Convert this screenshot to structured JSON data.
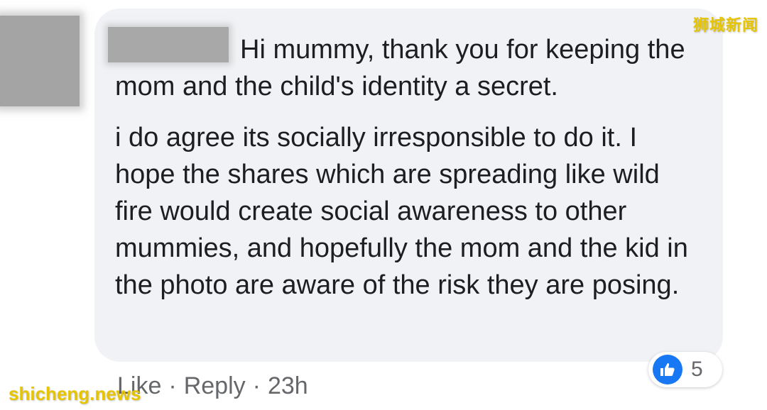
{
  "watermarks": {
    "top_right": "狮城新闻",
    "bottom_left": "shicheng.news"
  },
  "comment": {
    "author_name": "",
    "paragraphs": [
      "Hi mummy, thank you for keeping the mom and the child's identity a secret.",
      "i do agree its socially irresponsible to do it. I hope the shares which are spreading like wild fire would create social awareness to other mummies, and hopefully the mom and the kid in the photo are aware of the risk they are posing."
    ]
  },
  "actions": {
    "like_label": "Like",
    "separator": "·",
    "reply_label": "Reply",
    "timestamp": "23h"
  },
  "reactions": {
    "icon": "thumbs-up-icon",
    "count": "5",
    "color": "#1877f2"
  },
  "colors": {
    "bubble_background": "#f0f2f5",
    "text": "#1c1e21",
    "meta_text": "#65676b",
    "watermark": "#e6c400"
  }
}
